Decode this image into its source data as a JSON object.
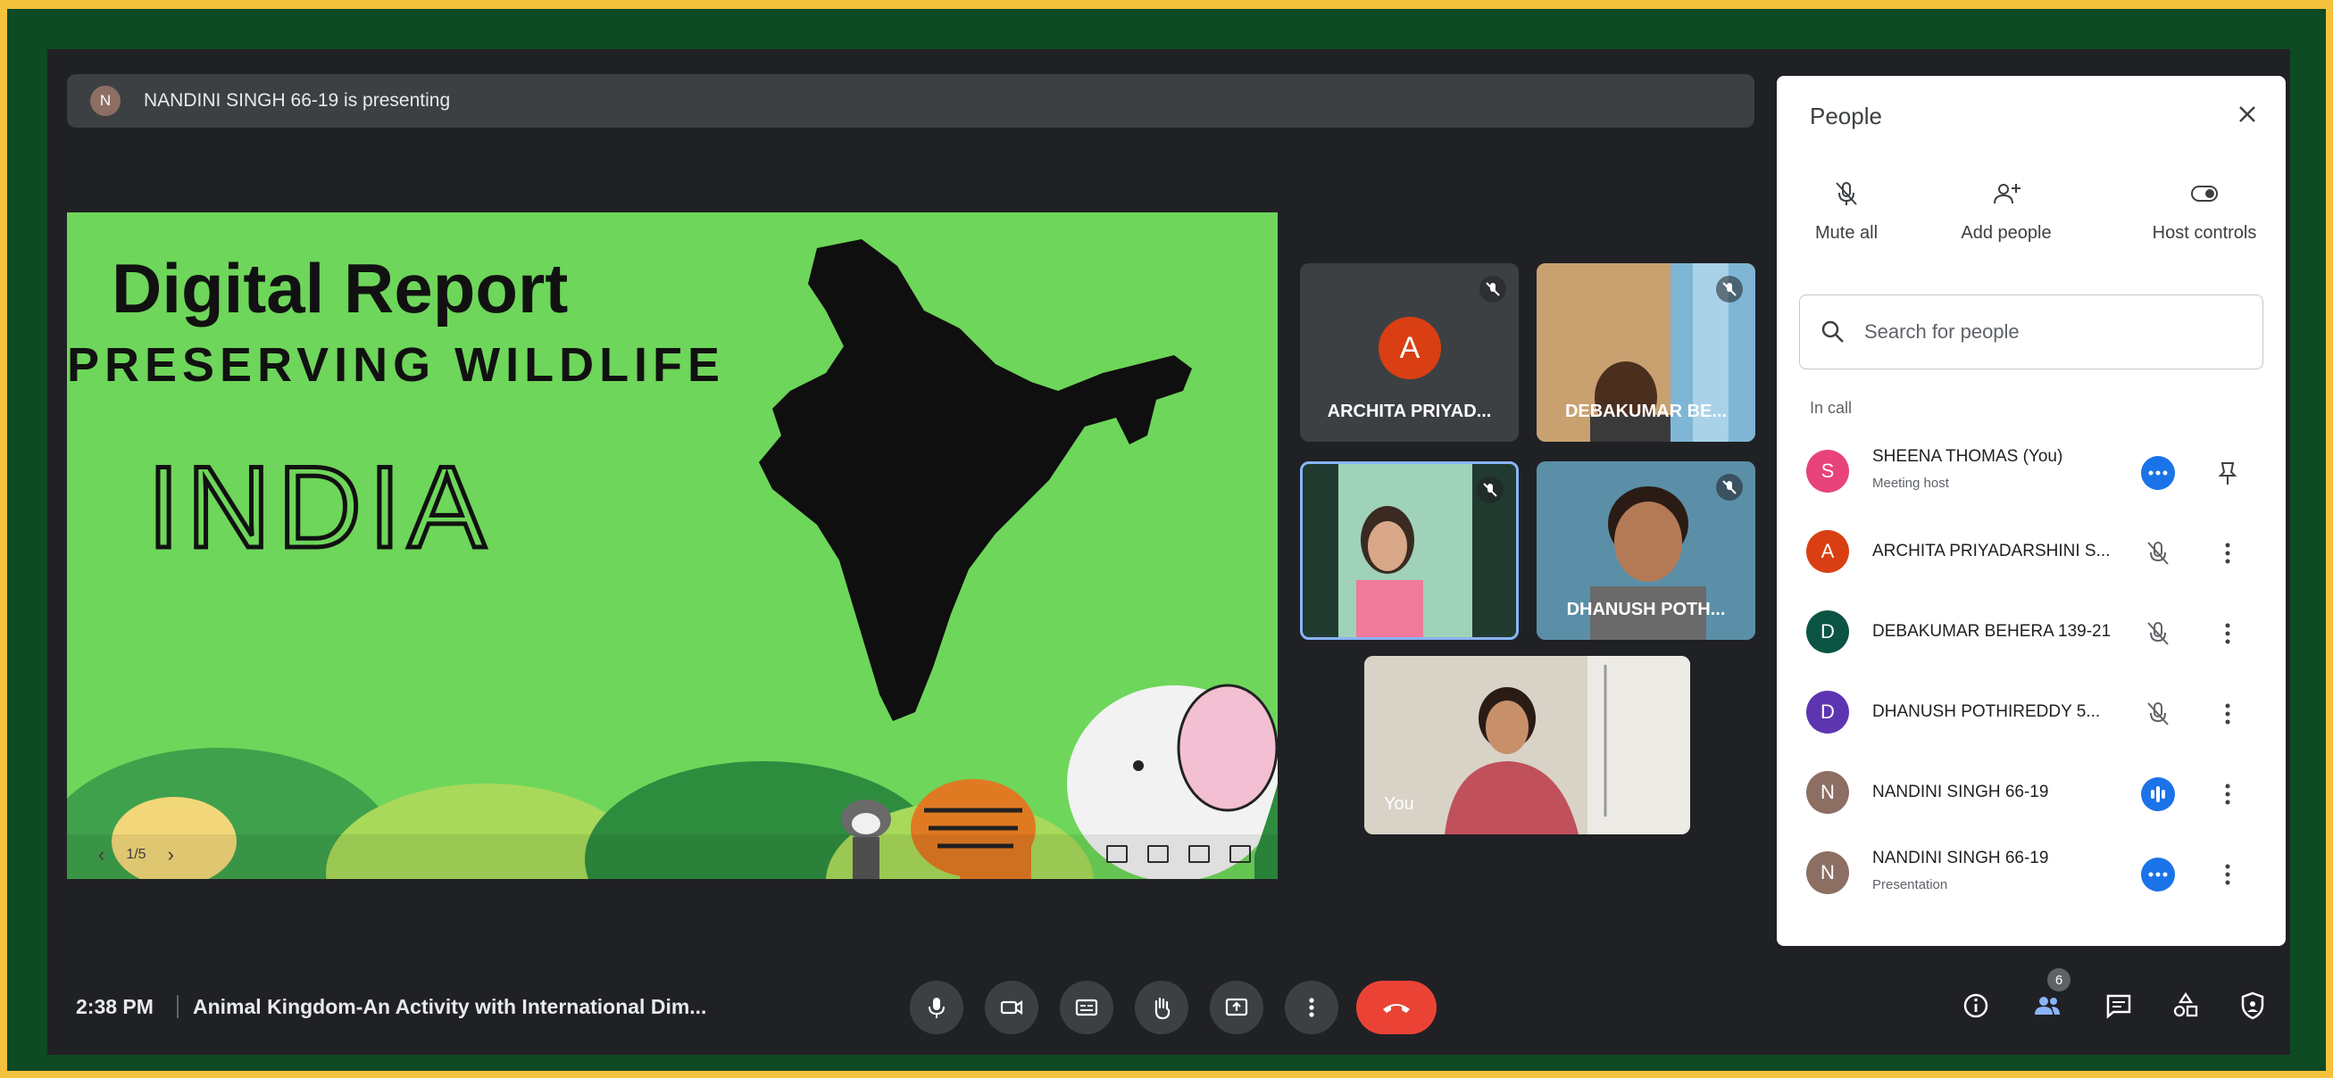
{
  "presenting": {
    "avatar_letter": "N",
    "text": "NANDINI SINGH 66-19 is presenting"
  },
  "slide": {
    "title": "Digital Report",
    "subtitle": "PRESERVING WILDLIFE",
    "heading": "INDIA",
    "page_indicator": "1/5"
  },
  "tiles": [
    {
      "name": "ARCHITA PRIYAD...",
      "avatar_letter": "A",
      "muted": true
    },
    {
      "name": "DEBAKUMAR BE...",
      "muted": true
    },
    {
      "name": "",
      "muted": true
    },
    {
      "name": "DHANUSH POTH...",
      "muted": true
    },
    {
      "name": "You",
      "muted": false
    }
  ],
  "people_panel": {
    "title": "People",
    "actions": [
      {
        "label": "Mute all",
        "icon": "mic-off-icon"
      },
      {
        "label": "Add people",
        "icon": "person-add-icon"
      },
      {
        "label": "Host controls",
        "icon": "toggle-icon"
      }
    ],
    "search_placeholder": "Search for people",
    "section_label": "In call",
    "participants": [
      {
        "letter": "S",
        "color": "#E8437B",
        "name": "SHEENA THOMAS (You)",
        "sub": "Meeting host",
        "status": "more-badge",
        "extra": "pin"
      },
      {
        "letter": "A",
        "color": "#D93F13",
        "name": "ARCHITA PRIYADARSHINI S...",
        "sub": "",
        "status": "muted"
      },
      {
        "letter": "D",
        "color": "#0B5443",
        "name": "DEBAKUMAR BEHERA 139-21",
        "sub": "",
        "status": "muted"
      },
      {
        "letter": "D",
        "color": "#5E35B1",
        "name": "DHANUSH POTHIREDDY 5...",
        "sub": "",
        "status": "muted"
      },
      {
        "letter": "N",
        "color": "#8D6E63",
        "name": "NANDINI SINGH 66-19",
        "sub": "",
        "status": "speaking"
      },
      {
        "letter": "N",
        "color": "#8D6E63",
        "name": "NANDINI SINGH 66-19",
        "sub": "Presentation",
        "status": "more-badge"
      }
    ]
  },
  "bottom_bar": {
    "time": "2:38 PM",
    "meeting_title": "Animal Kingdom-An Activity with International Dim...",
    "controls": [
      "mic-icon",
      "camera-icon",
      "captions-icon",
      "raise-hand-icon",
      "present-icon",
      "more-vert-icon"
    ],
    "end_call": "end-call-icon",
    "right_icons": [
      "info-icon",
      "people-icon",
      "chat-icon",
      "activities-icon",
      "host-shield-icon"
    ],
    "participant_count": "6"
  },
  "colors": {
    "frame_green": "#0E4A24",
    "frame_yellow": "#F4C23C",
    "slide_green": "#6ED65A",
    "end_red": "#EA4335",
    "accent_blue": "#1A73E8"
  }
}
